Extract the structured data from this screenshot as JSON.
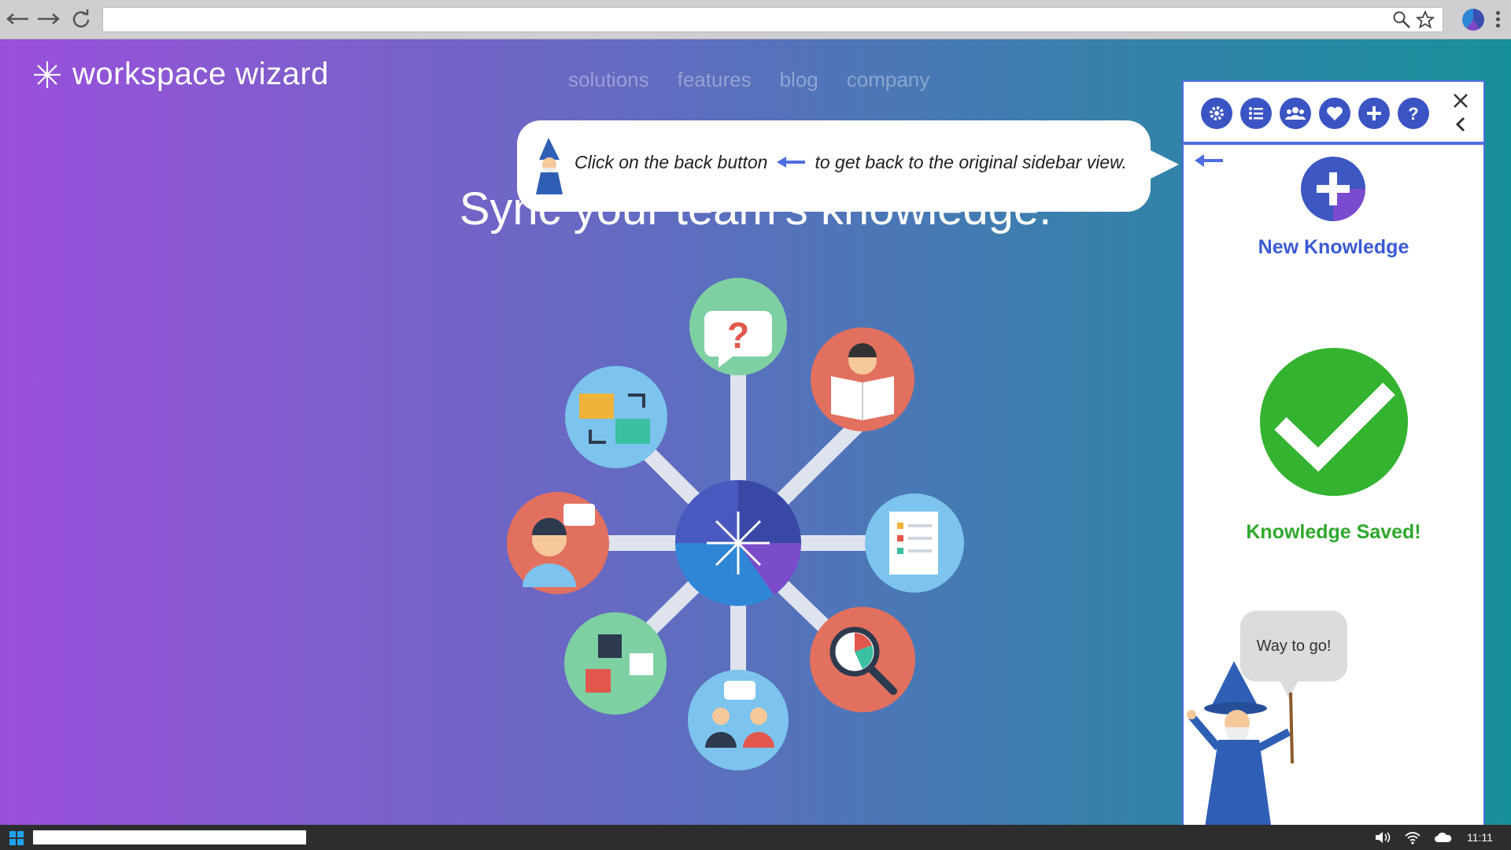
{
  "browser": {
    "url": "",
    "icons": [
      "back-arrow-icon",
      "forward-arrow-icon",
      "reload-icon",
      "search-icon",
      "star-icon",
      "profile-icon",
      "menu-icon"
    ]
  },
  "site": {
    "logo_text": "workspace wizard",
    "nav": [
      "solutions",
      "features",
      "blog",
      "company"
    ],
    "headline": "Sync your team's knowledge."
  },
  "callout": {
    "text_before": "Click on the back button",
    "text_after": "to get back to the original sidebar view."
  },
  "sidebar": {
    "tools": [
      "settings",
      "list",
      "team",
      "favorites",
      "add",
      "help"
    ],
    "new_knowledge_label": "New Knowledge",
    "saved_label": "Knowledge Saved!",
    "wizard_speech": "Way to go!"
  },
  "taskbar": {
    "clock": "11:11"
  },
  "colors": {
    "accent_blue": "#3b54c4",
    "sidebar_border": "#4d6de0",
    "success_green": "#33b330",
    "gradient_left": "#9a4fdc",
    "gradient_right": "#178f9a"
  }
}
